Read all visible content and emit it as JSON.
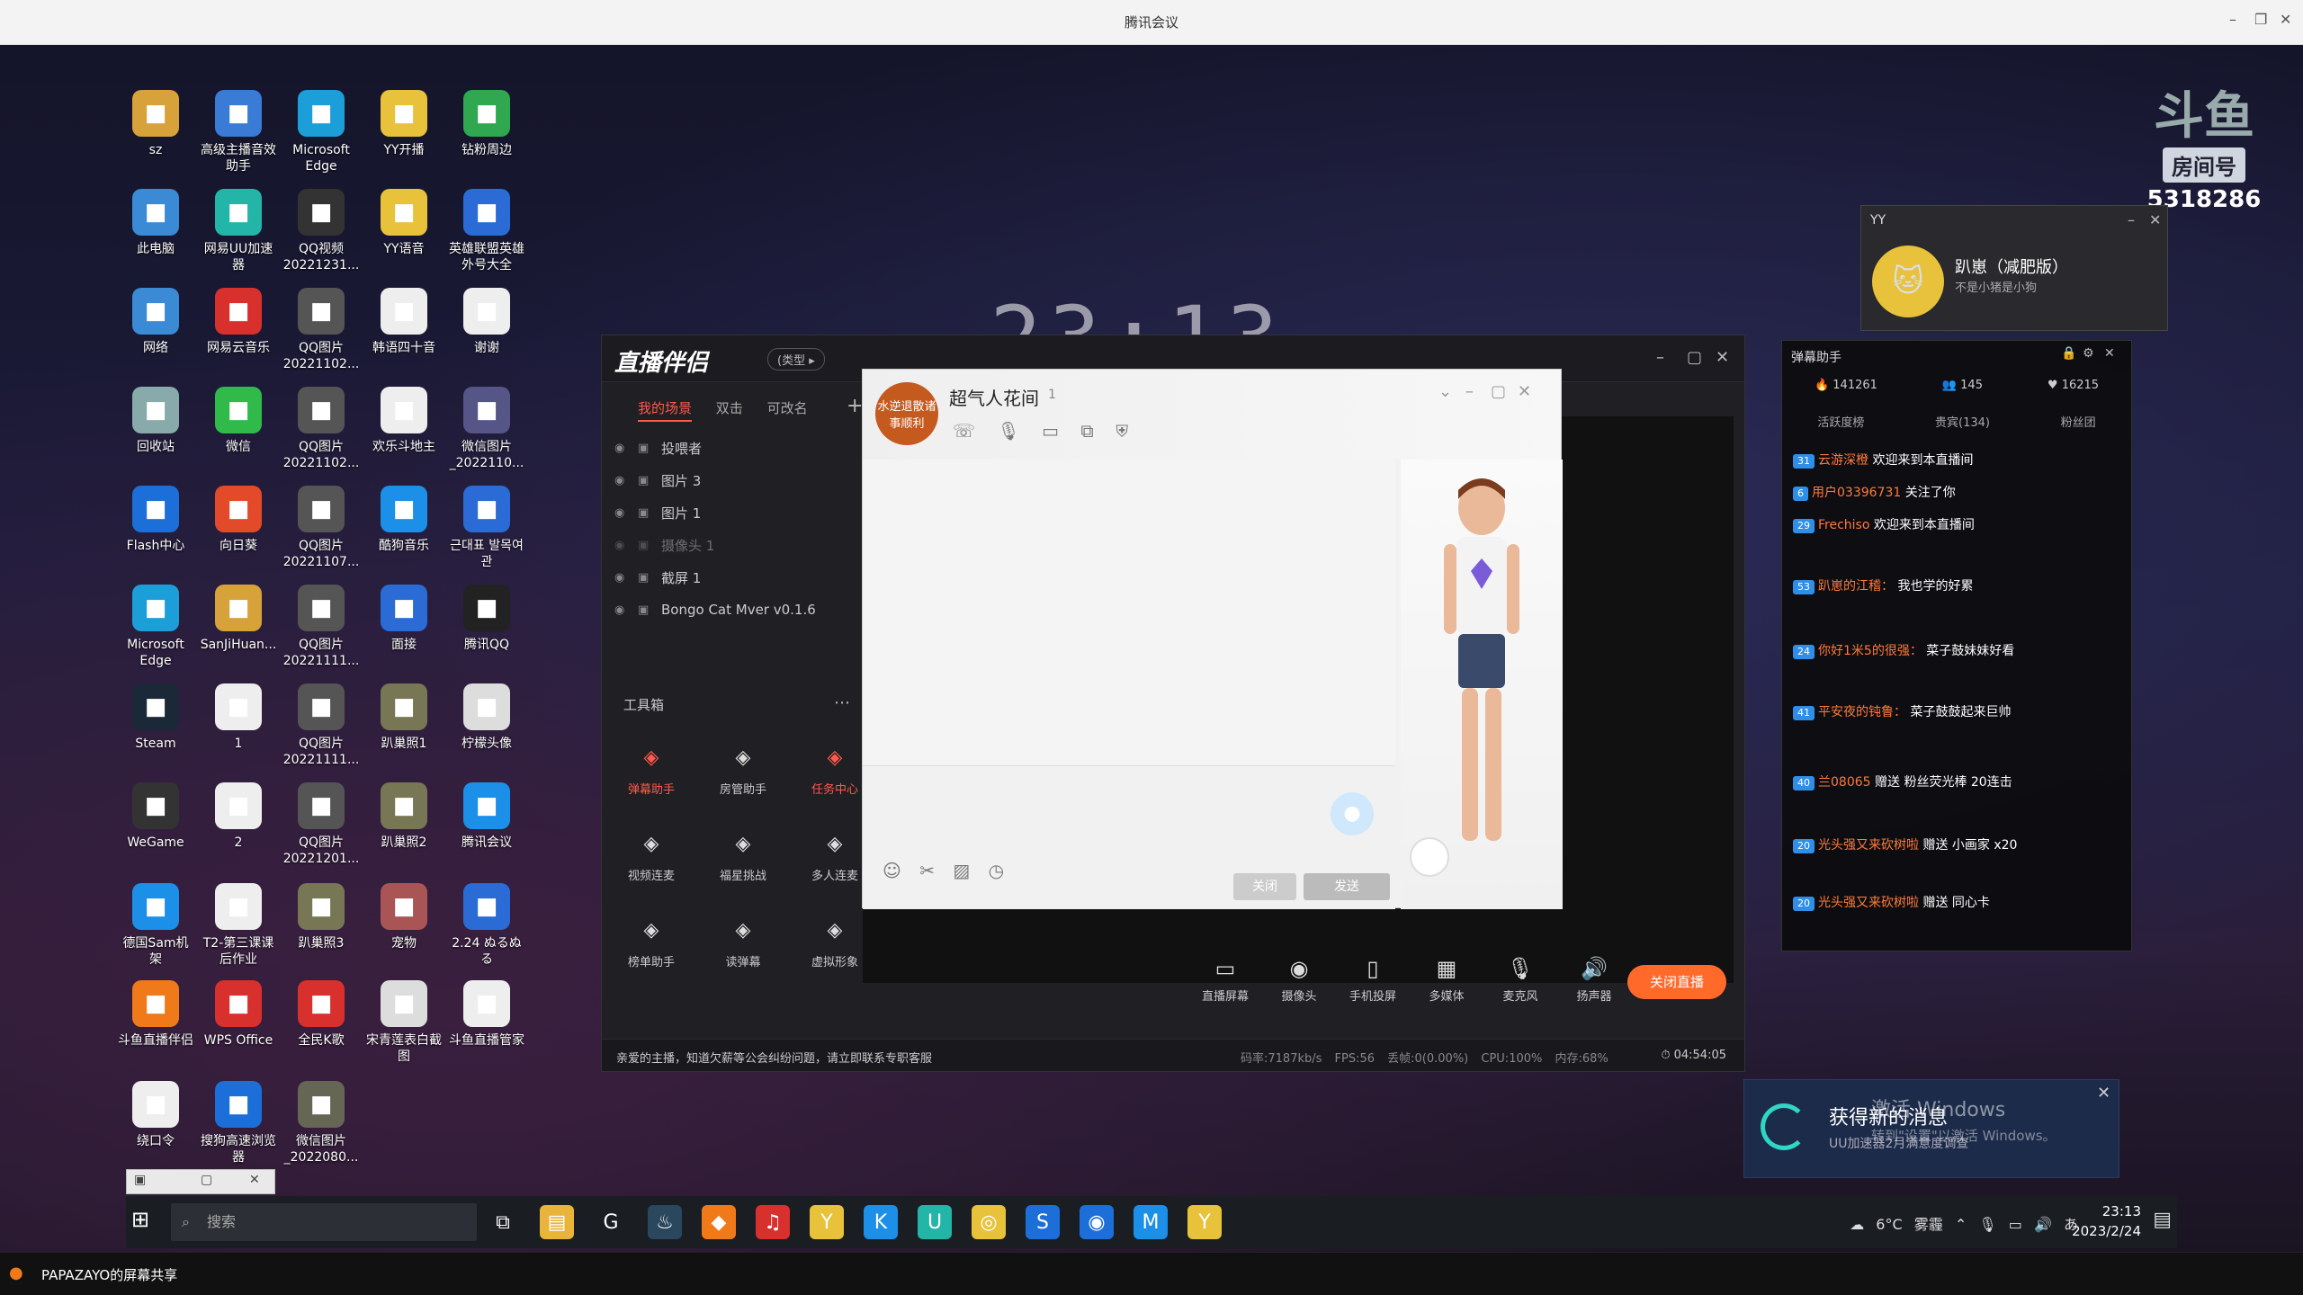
{
  "outer_window": {
    "title": "腾讯会议",
    "share_label": "PAPAZAYO的屏幕共享"
  },
  "clock_overlay": "23:13",
  "room": {
    "badge": "房间号",
    "number": "5318286"
  },
  "desktop_icons": [
    {
      "label": "sz",
      "icon": "folder-icon",
      "color": "#d8a23a"
    },
    {
      "label": "高级主播音效助手",
      "icon": "app-icon",
      "color": "#3a7bd5"
    },
    {
      "label": "Microsoft Edge",
      "icon": "edge-icon",
      "color": "#1c9fd8"
    },
    {
      "label": "YY开播",
      "icon": "yy-icon",
      "color": "#e8c23a"
    },
    {
      "label": "钻粉周边",
      "icon": "doc-icon",
      "color": "#2fa84f"
    },
    {
      "label": "此电脑",
      "icon": "computer-icon",
      "color": "#3a8ad5"
    },
    {
      "label": "网易UU加速器",
      "icon": "uu-icon",
      "color": "#23b5a8"
    },
    {
      "label": "QQ视频20221231...",
      "icon": "video-icon",
      "color": "#333"
    },
    {
      "label": "YY语音",
      "icon": "yy-icon",
      "color": "#e8c23a"
    },
    {
      "label": "英雄联盟英雄外号大全",
      "icon": "doc-icon",
      "color": "#2a6bd5"
    },
    {
      "label": "网络",
      "icon": "network-icon",
      "color": "#3a8ad5"
    },
    {
      "label": "网易云音乐",
      "icon": "music-icon",
      "color": "#d8302c"
    },
    {
      "label": "QQ图片20221102...",
      "icon": "image-icon",
      "color": "#555"
    },
    {
      "label": "韩语四十音",
      "icon": "doc-icon",
      "color": "#eee"
    },
    {
      "label": "谢谢",
      "icon": "doc-icon",
      "color": "#eee"
    },
    {
      "label": "回收站",
      "icon": "recycle-icon",
      "color": "#8aa"
    },
    {
      "label": "微信",
      "icon": "wechat-icon",
      "color": "#2fba4a"
    },
    {
      "label": "QQ图片20221102...",
      "icon": "image-icon",
      "color": "#555"
    },
    {
      "label": "欢乐斗地主",
      "icon": "doc-icon",
      "color": "#eee"
    },
    {
      "label": "微信图片_2022110...",
      "icon": "image-icon",
      "color": "#558"
    },
    {
      "label": "Flash中心",
      "icon": "flash-icon",
      "color": "#1c6fd8"
    },
    {
      "label": "向日葵",
      "icon": "sunflower-icon",
      "color": "#e24a2a"
    },
    {
      "label": "QQ图片20221107...",
      "icon": "image-icon",
      "color": "#555"
    },
    {
      "label": "酷狗音乐",
      "icon": "kugou-icon",
      "color": "#1c8fe8"
    },
    {
      "label": "근대표 발목여관",
      "icon": "doc-icon",
      "color": "#2a6bd5"
    },
    {
      "label": "Microsoft Edge",
      "icon": "edge-icon",
      "color": "#1c9fd8"
    },
    {
      "label": "SanJiHuan...",
      "icon": "folder-icon",
      "color": "#d8a23a"
    },
    {
      "label": "QQ图片20221111...",
      "icon": "image-icon",
      "color": "#555"
    },
    {
      "label": "面接",
      "icon": "doc-icon",
      "color": "#2a6bd5"
    },
    {
      "label": "腾讯QQ",
      "icon": "qq-icon",
      "color": "#222"
    },
    {
      "label": "Steam",
      "icon": "steam-icon",
      "color": "#1b2838"
    },
    {
      "label": "1",
      "icon": "doc-icon",
      "color": "#eee"
    },
    {
      "label": "QQ图片20221111...",
      "icon": "image-icon",
      "color": "#555"
    },
    {
      "label": "趴巢照1",
      "icon": "image-icon",
      "color": "#775"
    },
    {
      "label": "柠檬头像",
      "icon": "image-icon",
      "color": "#ddd"
    },
    {
      "label": "WeGame",
      "icon": "wegame-icon",
      "color": "#333"
    },
    {
      "label": "2",
      "icon": "doc-icon",
      "color": "#eee"
    },
    {
      "label": "QQ图片20221201...",
      "icon": "image-icon",
      "color": "#555"
    },
    {
      "label": "趴巢照2",
      "icon": "image-icon",
      "color": "#775"
    },
    {
      "label": "腾讯会议",
      "icon": "meeting-icon",
      "color": "#1c8fe8"
    },
    {
      "label": "德国Sam机架",
      "icon": "app-icon",
      "color": "#1c8fe8"
    },
    {
      "label": "T2-第三课课后作业",
      "icon": "doc-icon",
      "color": "#eee"
    },
    {
      "label": "趴巢照3",
      "icon": "image-icon",
      "color": "#775"
    },
    {
      "label": "宠物",
      "icon": "image-icon",
      "color": "#a55"
    },
    {
      "label": "2.24 ぬるぬる",
      "icon": "doc-icon",
      "color": "#2a6bd5"
    },
    {
      "label": "斗鱼直播伴侣",
      "icon": "douyu-icon",
      "color": "#f07a1a"
    },
    {
      "label": "WPS Office",
      "icon": "wps-icon",
      "color": "#d8302c"
    },
    {
      "label": "全民K歌",
      "icon": "karaoke-icon",
      "color": "#d8302c"
    },
    {
      "label": "宋青莲表白截图",
      "icon": "image-icon",
      "color": "#ddd"
    },
    {
      "label": "斗鱼直播管家",
      "icon": "doc-icon",
      "color": "#eee"
    },
    {
      "label": "绕口令",
      "icon": "doc-icon",
      "color": "#eee"
    },
    {
      "label": "搜狗高速浏览器",
      "icon": "sogou-icon",
      "color": "#1c6fd8"
    },
    {
      "label": "微信图片_2022080...",
      "icon": "image-icon",
      "color": "#665"
    }
  ],
  "companion": {
    "logo": "直播伴侣",
    "pill": "(类型 ▸",
    "scene_tabs": [
      "我的场景",
      "双击",
      "可改名"
    ],
    "sources": [
      "投喂者",
      "图片 3",
      "图片 1",
      "摄像头 1",
      "截屏 1",
      "Bongo Cat Mver v0.1.6"
    ],
    "toolbox_title": "工具箱",
    "tools": [
      {
        "label": "弹幕助手",
        "icon": "danmaku-icon"
      },
      {
        "label": "房管助手",
        "icon": "admin-icon"
      },
      {
        "label": "任务中心",
        "icon": "task-icon"
      },
      {
        "label": "视频连麦",
        "icon": "video-link-icon"
      },
      {
        "label": "福星挑战",
        "icon": "challenge-icon"
      },
      {
        "label": "多人连麦",
        "icon": "multi-link-icon"
      },
      {
        "label": "榜单助手",
        "icon": "rank-icon"
      },
      {
        "label": "读弹幕",
        "icon": "read-icon"
      },
      {
        "label": "虚拟形象",
        "icon": "avatar-icon"
      }
    ],
    "bottom_tools": [
      "直播屏幕",
      "摄像头",
      "手机投屏",
      "多媒体",
      "麦克风",
      "扬声器"
    ],
    "close_live": "关闭直播",
    "notice": "亲爱的主播，知道欠薪等公会纠纷问题，请立即联系专职客服",
    "stats": "码率:7187kb/s FPS:56 丢帧:0(0.00%) CPU:100% 内存:68%",
    "duration": "04:54:05"
  },
  "chat": {
    "avatar_text": "水逆退散诸事顺利",
    "name": "超气人花间",
    "count": "1",
    "close_btn": "关闭",
    "send_btn": "发送"
  },
  "yy_panel": {
    "title": "YY",
    "name": "趴崽（减肥版）",
    "sub": "不是小猪是小狗"
  },
  "danmaku": {
    "title": "弹幕助手",
    "stats": [
      "141261",
      "145",
      "16215"
    ],
    "tabs": [
      "活跃度榜",
      "贵宾(134)",
      "粉丝团"
    ],
    "messages": [
      {
        "badge": "31",
        "user": "云游深橙",
        "text": "欢迎来到本直播间"
      },
      {
        "badge": "6",
        "user": "用户03396731",
        "text": "关注了你"
      },
      {
        "badge": "29",
        "user": "Frechiso",
        "text": "欢迎来到本直播间"
      },
      {
        "badge": "53",
        "user": "趴崽的江稽：",
        "text": "我也学的好累"
      },
      {
        "badge": "24",
        "user": "你好1米5的很强：",
        "text": "菜子鼓妹妹好看"
      },
      {
        "badge": "41",
        "user": "平安夜的钝鲁：",
        "text": "菜子鼓鼓起来巨帅"
      },
      {
        "badge": "40",
        "user": "兰08065",
        "text": "赠送 粉丝荧光棒 20连击"
      },
      {
        "badge": "20",
        "user": "光头强又来砍树啦",
        "text": "赠送 小画家 x20"
      },
      {
        "badge": "20",
        "user": "光头强又来砍树啦",
        "text": "赠送 同心卡"
      }
    ]
  },
  "toast": {
    "title": "获得新的消息",
    "sub": "UU加速器2月满意度调查"
  },
  "activate": {
    "line1": "激活 Windows",
    "line2": "转到\"设置\"以激活 Windows。"
  },
  "taskbar": {
    "search": "搜索",
    "weather": "6°C 雾霾",
    "time": "23:13",
    "date": "2023/2/24",
    "ime": "あ",
    "apps": [
      {
        "name": "task-view-icon",
        "glyph": "⧉",
        "color": "#1a1d22"
      },
      {
        "name": "explorer-icon",
        "glyph": "▤",
        "color": "#e8b53a"
      },
      {
        "name": "app-g-icon",
        "glyph": "G",
        "color": "#1a1d22"
      },
      {
        "name": "steam-icon",
        "glyph": "♨",
        "color": "#2a475e"
      },
      {
        "name": "douyu-icon",
        "glyph": "◆",
        "color": "#f07a1a"
      },
      {
        "name": "music-icon",
        "glyph": "♫",
        "color": "#d8302c"
      },
      {
        "name": "yy-icon",
        "glyph": "Y",
        "color": "#e8c23a"
      },
      {
        "name": "kugou-icon",
        "glyph": "K",
        "color": "#1c8fe8"
      },
      {
        "name": "uu-icon",
        "glyph": "U",
        "color": "#23b5a8"
      },
      {
        "name": "yy-live-icon",
        "glyph": "◎",
        "color": "#e8c23a"
      },
      {
        "name": "sogou-icon",
        "glyph": "S",
        "color": "#1c6fd8"
      },
      {
        "name": "browser-icon",
        "glyph": "◉",
        "color": "#1c6fd8"
      },
      {
        "name": "meeting-icon",
        "glyph": "M",
        "color": "#1c8fe8"
      },
      {
        "name": "yy-voice-icon",
        "glyph": "Y",
        "color": "#e8c23a"
      }
    ]
  }
}
